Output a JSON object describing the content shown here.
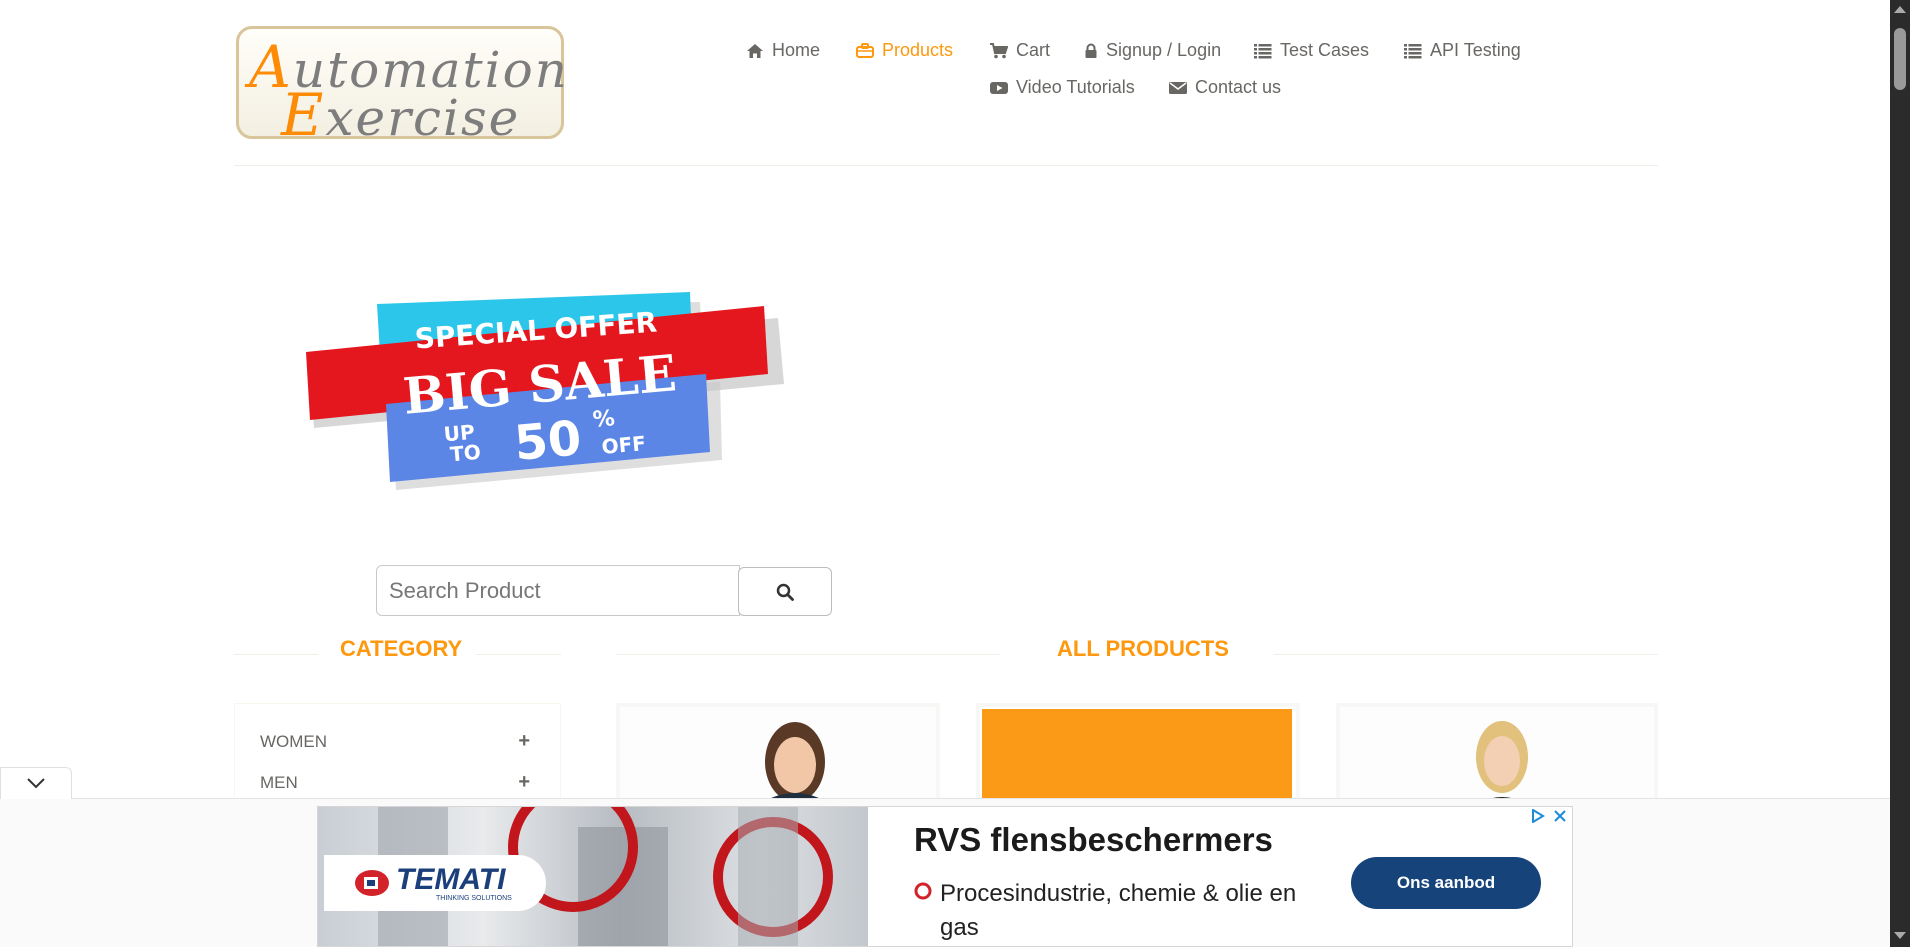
{
  "logo": {
    "line1_cap": "A",
    "line1_rest": "utomation",
    "line2_cap": "E",
    "line2_rest": "xercise"
  },
  "nav": [
    {
      "label": "Home",
      "icon": "home-icon"
    },
    {
      "label": "Products",
      "icon": "briefcase-icon",
      "active": true
    },
    {
      "label": "Cart",
      "icon": "cart-icon"
    },
    {
      "label": "Signup / Login",
      "icon": "lock-icon"
    },
    {
      "label": "Test Cases",
      "icon": "list-icon"
    },
    {
      "label": "API Testing",
      "icon": "list-icon"
    },
    {
      "label": "Video Tutorials",
      "icon": "youtube-icon"
    },
    {
      "label": "Contact us",
      "icon": "envelope-icon"
    }
  ],
  "banner": {
    "top": "SPECIAL OFFER",
    "middle": "BIG SALE",
    "up": "UP",
    "to": "TO",
    "percent": "50",
    "pct_sign": "%",
    "off": "OFF"
  },
  "search": {
    "placeholder": "Search Product",
    "icon": "search-icon"
  },
  "sections": {
    "category": "CATEGORY",
    "products": "ALL PRODUCTS"
  },
  "categories": [
    {
      "label": "WOMEN",
      "icon": "plus-icon"
    },
    {
      "label": "MEN",
      "icon": "plus-icon"
    }
  ],
  "ad": {
    "brand": "TEMATI",
    "tagline": "THINKING SOLUTIONS",
    "headline": "RVS flensbeschermers",
    "sub": "Procesindustrie, chemie & olie en gas",
    "cta": "Ons aanbod"
  },
  "colors": {
    "accent": "#fe980f",
    "ad_cta": "#15437a",
    "text": "#696763"
  }
}
